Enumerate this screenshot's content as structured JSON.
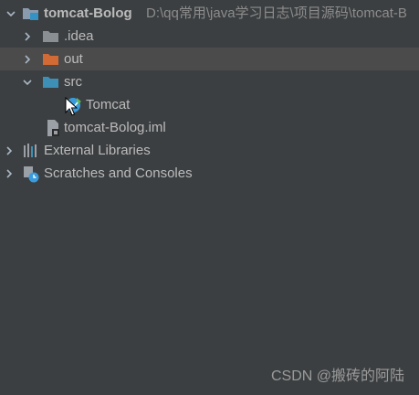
{
  "tree": {
    "root": {
      "label": "tomcat-Bolog",
      "path": "D:\\qq常用\\java学习日志\\项目源码\\tomcat-B",
      "icon": "project-folder-icon"
    },
    "items": [
      {
        "label": ".idea",
        "icon": "folder-icon",
        "color": "#8a8f94"
      },
      {
        "label": "out",
        "icon": "excluded-folder-icon",
        "color": "#d16a34"
      },
      {
        "label": "src",
        "icon": "source-folder-icon",
        "color": "#3d8fb5"
      },
      {
        "label": "Tomcat",
        "icon": "servlet-class-icon"
      },
      {
        "label": "tomcat-Bolog.iml",
        "icon": "module-file-icon"
      },
      {
        "label": "External Libraries",
        "icon": "libraries-icon"
      },
      {
        "label": "Scratches and Consoles",
        "icon": "scratches-icon"
      }
    ]
  },
  "watermark": "CSDN @搬砖的阿陆",
  "colors": {
    "background": "#3c3f41",
    "selected_row": "#4b4b4b",
    "text": "#bbbbbb",
    "path_text": "#8c8c8c"
  }
}
